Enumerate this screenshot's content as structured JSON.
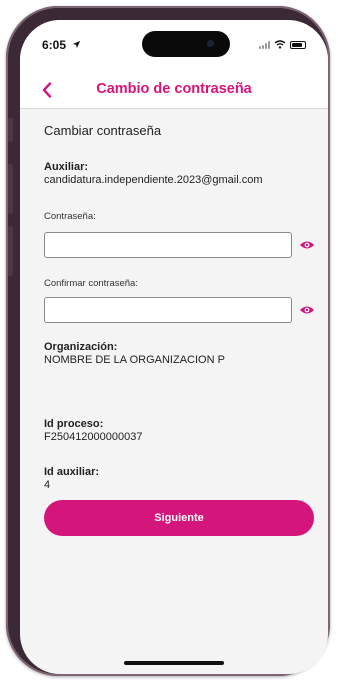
{
  "status_bar": {
    "time": "6:05"
  },
  "nav": {
    "title": "Cambio de contraseña"
  },
  "form": {
    "section_title": "Cambiar contraseña",
    "auxiliar_label": "Auxiliar:",
    "auxiliar_value": "candidatura.independiente.2023@gmail.com",
    "password_label": "Contraseña:",
    "password_value": "",
    "confirm_label": "Confirmar contraseña:",
    "confirm_value": "",
    "organizacion_label": "Organización:",
    "organizacion_value": "NOMBRE DE LA ORGANIZACION P",
    "id_proceso_label": "Id proceso:",
    "id_proceso_value": "F250412000000037",
    "id_auxiliar_label": "Id auxiliar:",
    "id_auxiliar_value": "4"
  },
  "actions": {
    "next_label": "Siguiente"
  },
  "colors": {
    "accent": "#d4157c",
    "frame": "#3b2a36",
    "background": "#f4f4f4"
  },
  "icons": {
    "back": "chevron-left-icon",
    "show_password": "eye-icon"
  }
}
